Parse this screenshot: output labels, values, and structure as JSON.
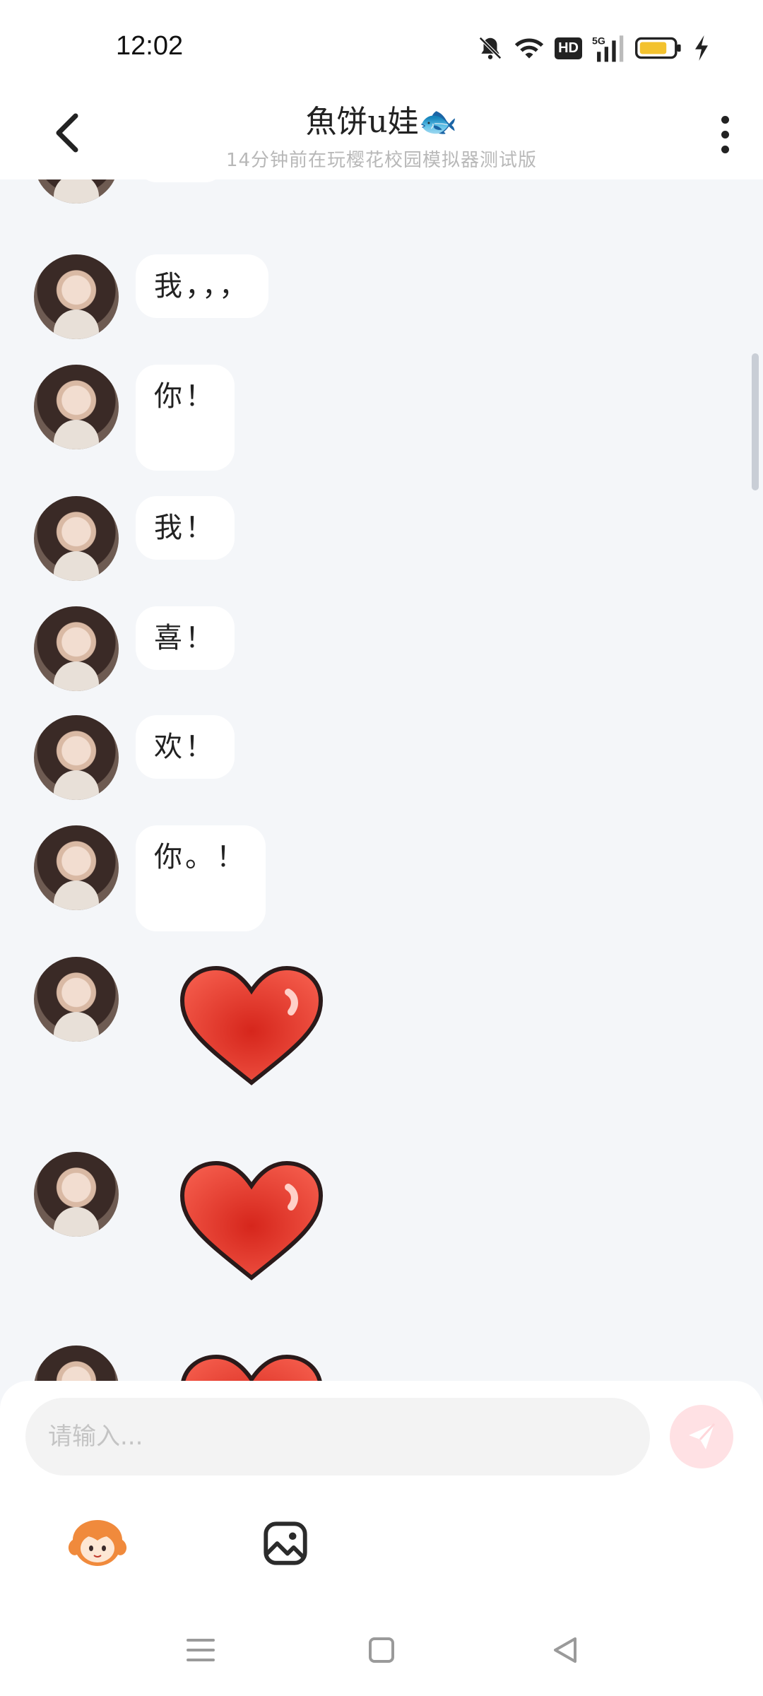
{
  "status_bar": {
    "time": "12:02",
    "hd_label": "HD",
    "network_label": "5G"
  },
  "header": {
    "title": "魚饼u娃🐟",
    "subtitle": "14分钟前在玩樱花校园模拟器测试版"
  },
  "messages": [
    {
      "type": "text",
      "text": "???"
    },
    {
      "type": "text",
      "text": "我，，，"
    },
    {
      "type": "text",
      "text": "你！"
    },
    {
      "type": "text",
      "text": "我！"
    },
    {
      "type": "text",
      "text": "喜！"
    },
    {
      "type": "text",
      "text": "欢！"
    },
    {
      "type": "text",
      "text": "你。！"
    },
    {
      "type": "sticker",
      "icon": "red-heart-sticker"
    },
    {
      "type": "sticker",
      "icon": "red-heart-sticker"
    },
    {
      "type": "sticker",
      "icon": "red-heart-sticker"
    }
  ],
  "input": {
    "placeholder": "请输入..."
  },
  "colors": {
    "bubble": "#ffffff",
    "background": "#f4f6f9",
    "send_button": "#ffe1e4",
    "heart": "#e8372c"
  }
}
